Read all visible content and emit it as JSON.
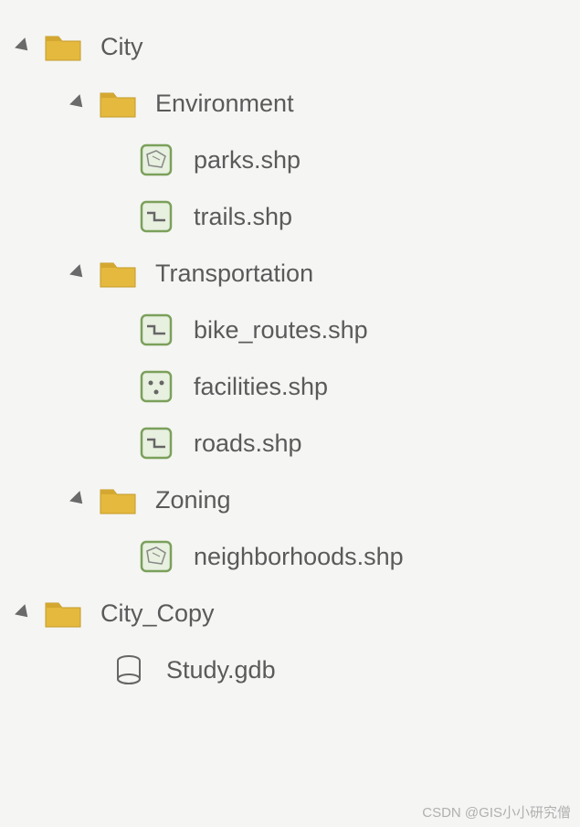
{
  "tree": {
    "city": {
      "label": "City",
      "environment": {
        "label": "Environment",
        "parks": "parks.shp",
        "trails": "trails.shp"
      },
      "transportation": {
        "label": "Transportation",
        "bike_routes": "bike_routes.shp",
        "facilities": "facilities.shp",
        "roads": "roads.shp"
      },
      "zoning": {
        "label": "Zoning",
        "neighborhoods": "neighborhoods.shp"
      }
    },
    "city_copy": {
      "label": "City_Copy",
      "study": "Study.gdb"
    }
  },
  "watermark": "CSDN @GIS小小研究僧"
}
